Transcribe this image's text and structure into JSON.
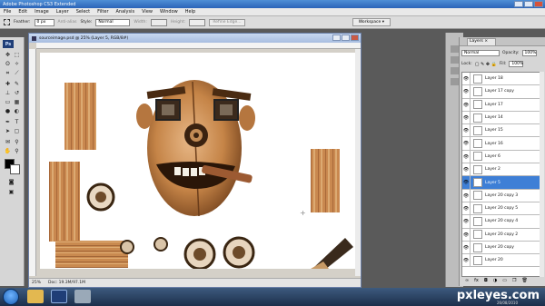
{
  "window": {
    "title": "Adobe Photoshop CS3 Extended"
  },
  "menu": [
    "File",
    "Edit",
    "Image",
    "Layer",
    "Select",
    "Filter",
    "Analysis",
    "View",
    "Window",
    "Help"
  ],
  "options": {
    "feather_label": "Feather:",
    "feather_value": "0 px",
    "antialias_label": "Anti-alias",
    "style_label": "Style:",
    "style_value": "Normal",
    "width_label": "Width:",
    "height_label": "Height:",
    "refine_label": "Refine Edge...",
    "workspace_label": "Workspace"
  },
  "document": {
    "title": "sourceimage.psd @ 25% (Layer 5, RGB/8#)",
    "zoom": "25%",
    "doc_size": "Doc: 19.3M/97.1M"
  },
  "layers_panel": {
    "tab_label": "Layers ×",
    "blend_mode": "Normal",
    "opacity_label": "Opacity:",
    "opacity_value": "100%",
    "lock_label": "Lock:",
    "fill_label": "Fill:",
    "fill_value": "100%",
    "layers": [
      {
        "name": "Layer 18",
        "selected": false
      },
      {
        "name": "Layer 17 copy",
        "selected": false
      },
      {
        "name": "Layer 17",
        "selected": false
      },
      {
        "name": "Layer 14",
        "selected": false
      },
      {
        "name": "Layer 15",
        "selected": false
      },
      {
        "name": "Layer 16",
        "selected": false
      },
      {
        "name": "Layer 6",
        "selected": false
      },
      {
        "name": "Layer 2",
        "selected": false
      },
      {
        "name": "Layer 5",
        "selected": true
      },
      {
        "name": "Layer 20 copy 3",
        "selected": false
      },
      {
        "name": "Layer 20 copy 5",
        "selected": false
      },
      {
        "name": "Layer 20 copy 4",
        "selected": false
      },
      {
        "name": "Layer 20 copy 2",
        "selected": false
      },
      {
        "name": "Layer 20 copy",
        "selected": false
      },
      {
        "name": "Layer 20",
        "selected": false
      }
    ]
  },
  "watermark": {
    "site": "pxleyes.com",
    "date": "26/08/2010"
  },
  "colors": {
    "selected_layer": "#3e7fd6",
    "title_bar": "#2b64b8"
  }
}
